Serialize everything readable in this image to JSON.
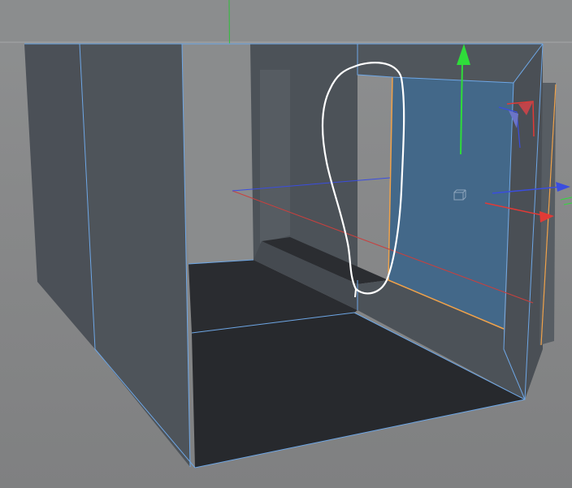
{
  "viewport": {
    "background_color": "#8a8b8c",
    "horizon_line_color": "#a0a2a4"
  },
  "scene": {
    "object_fill_dark": "#4a4f55",
    "object_fill_mid": "#50565c",
    "floor_fill": "#27292d",
    "edge_color": "#6ea7e6",
    "selected_polygon_color": "#436889",
    "selected_edge_color": "#f0a24a"
  },
  "axes": {
    "x_color": "#e23a36",
    "y_color": "#2fdc3a",
    "z_color": "#3a4de0"
  },
  "gizmo": {
    "icon": "move-tool-gizmo-icon",
    "center_icon": "cube-object-icon"
  },
  "annotation": {
    "icon": "freehand-highlight-stroke-icon",
    "stroke_color": "#ffffff"
  }
}
